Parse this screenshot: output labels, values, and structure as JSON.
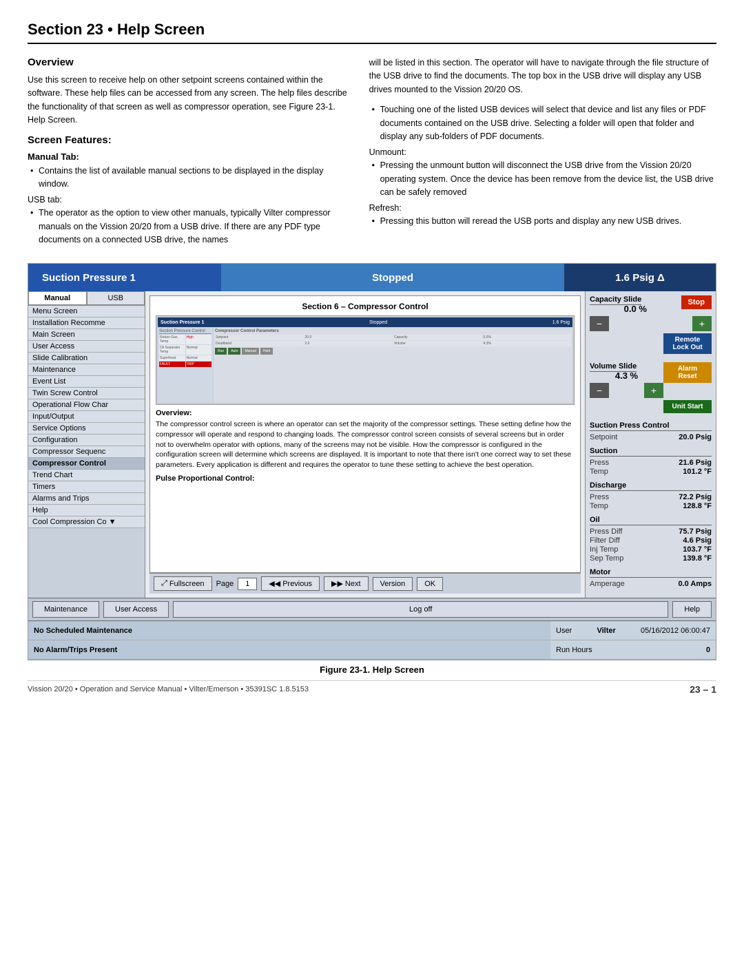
{
  "header": {
    "title": "Section 23 • Help Screen"
  },
  "overview": {
    "heading": "Overview",
    "paragraph": "Use this screen to receive help on other setpoint screens contained within the software. These help files can be accessed from any screen. The help files describe the functionality of that screen as well as compressor operation, see Figure 23-1. Help Screen."
  },
  "screen_features": {
    "heading": "Screen Features:",
    "manual_tab_label": "Manual Tab:",
    "manual_tab_bullet": "Contains the list of available manual sections to be displayed in the display window.",
    "usb_tab_label": "USB tab:",
    "usb_tab_bullet": "The operator as the option to view other manuals, typically Vilter compressor manuals on the Vission 20/20 from a USB drive. If there are any PDF type documents on a connected USB drive, the names"
  },
  "right_col": {
    "para1": "will be listed in this section. The operator will have to navigate through the file structure of the USB drive to find the documents. The top box in the USB drive will display any USB drives mounted to the Vission 20/20 OS.",
    "bullet1": "Touching one of the listed USB devices will select that device and list any files or PDF documents contained on the USB drive. Selecting a folder will open that folder and display any sub-folders of PDF documents.",
    "unmount_label": "Unmount:",
    "unmount_bullet": "Pressing the unmount button will disconnect the USB drive from the Vission 20/20 operating system. Once the device has been remove from the device list, the USB drive can be safely removed",
    "refresh_label": "Refresh:",
    "refresh_bullet": "Pressing this button will reread the USB ports and display any new USB drives."
  },
  "figure": {
    "caption": "Figure 23-1. Help Screen",
    "status_bar": {
      "suction": "Suction Pressure 1",
      "stopped": "Stopped",
      "psig": "1.6 Psig Δ"
    },
    "tabs": [
      "Manual",
      "USB"
    ],
    "nav_items": [
      "Menu Screen",
      "Installation Recomme",
      "Main Screen",
      "User Access",
      "Slide Calibration",
      "Maintenance",
      "Event List",
      "Twin Screw Control",
      "Operational Flow Char",
      "Input/Output",
      "Service Options",
      "Configuration",
      "Compressor Sequenc",
      "Compressor Control",
      "Trend Chart",
      "Timers",
      "Alarms and Trips",
      "Help",
      "Cool Compression Co"
    ],
    "content": {
      "title": "Section 6 – Compressor Control",
      "overview_heading": "Overview:",
      "overview_text": "The compressor control screen is where an operator can set the majority of the compressor settings. These setting define how the compressor will operate and respond to changing loads. The compressor control screen consists of several screens but in order not to overwhelm operator with options, many of the screens may not be visible. How the compressor is configured in the configuration screen will determine which screens are displayed. It is important to note that there isn't one correct way to set these parameters. Every application is different and requires the operator to tune these setting to achieve the best operation.",
      "pulse_label": "Pulse Proportional Control:"
    },
    "controls": {
      "fullscreen": "Fullscreen",
      "page_label": "Page",
      "page_value": "1",
      "previous": "Previous",
      "next": "Next",
      "version": "Version",
      "ok": "OK"
    },
    "right_panel": {
      "capacity_title": "Capacity Slide",
      "stop_btn": "Stop",
      "capacity_value": "0.0 %",
      "remote_btn": "Remote\nLock Out",
      "volume_title": "Volume Slide",
      "alarm_btn": "Alarm Reset",
      "volume_value": "4.3 %",
      "unit_btn": "Unit Start",
      "suction_press_title": "Suction Press Control",
      "setpoint_label": "Setpoint",
      "setpoint_value": "20.0 Psig",
      "suction_title": "Suction",
      "press_label": "Press",
      "press_value": "21.6 Psig",
      "temp_label": "Temp",
      "temp_value": "101.2 °F",
      "discharge_title": "Discharge",
      "dis_press_value": "72.2 Psig",
      "dis_temp_value": "128.8 °F",
      "oil_title": "Oil",
      "press_diff_label": "Press Diff",
      "press_diff_value": "75.7 Psig",
      "filter_diff_label": "Filter Diff",
      "filter_diff_value": "4.6 Psig",
      "inj_temp_label": "Inj Temp",
      "inj_temp_value": "103.7 °F",
      "sep_temp_label": "Sep Temp",
      "sep_temp_value": "139.8 °F",
      "motor_title": "Motor",
      "amperage_label": "Amperage",
      "amperage_value": "0.0 Amps"
    },
    "action_bar": {
      "maintenance": "Maintenance",
      "user_access": "User Access",
      "log_off": "Log off",
      "help": "Help"
    },
    "status_rows": {
      "row1_left": "No Scheduled Maintenance",
      "row1_user_label": "User",
      "row1_user_value": "Vilter",
      "row1_date": "05/16/2012  06:00:47",
      "row2_left": "No Alarm/Trips Present",
      "row2_run_label": "Run Hours",
      "row2_run_value": "0"
    }
  },
  "footer": {
    "left": "Vission 20/20 • Operation and Service Manual • Vilter/Emerson • 35391SC 1.8.5153",
    "right": "23 – 1"
  }
}
